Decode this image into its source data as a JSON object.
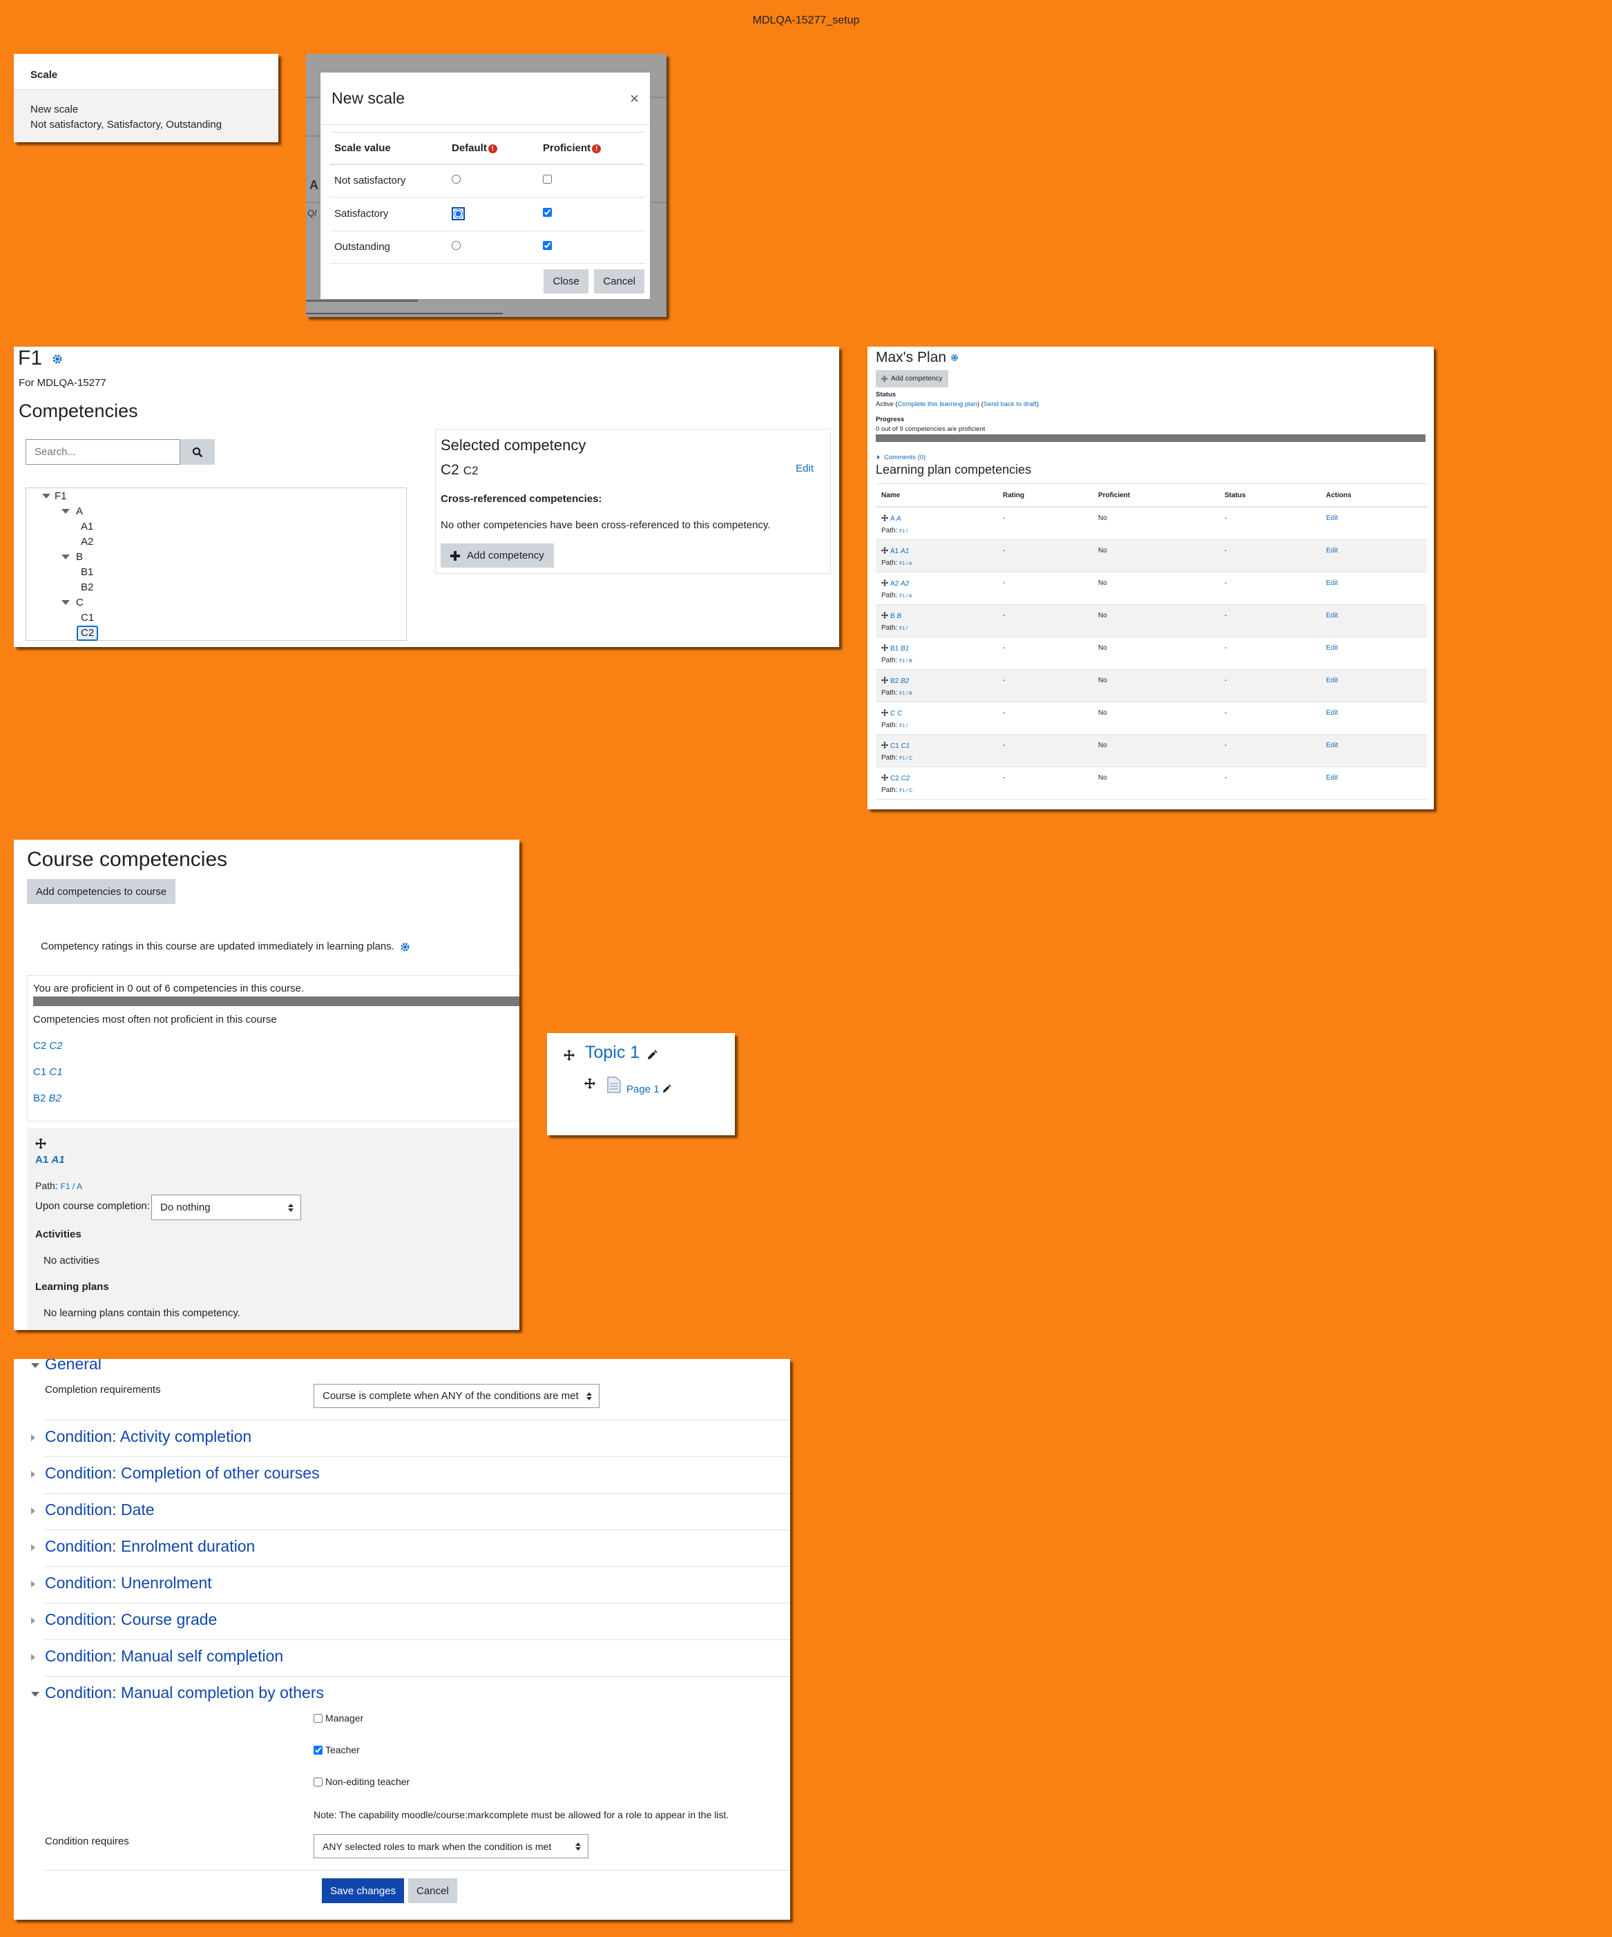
{
  "page_title": "MDLQA-15277_setup",
  "scale_panel": {
    "header": "Scale",
    "name": "New scale",
    "items": "Not satisfactory, Satisfactory, Outstanding"
  },
  "modal": {
    "bg_letters": [
      "A",
      "Q/"
    ],
    "title": "New scale",
    "close_symbol": "×",
    "columns": [
      "Scale value",
      "Default",
      "Proficient"
    ],
    "rows": [
      {
        "label": "Not satisfactory",
        "default": false,
        "proficient": false
      },
      {
        "label": "Satisfactory",
        "default": true,
        "proficient": true
      },
      {
        "label": "Outstanding",
        "default": false,
        "proficient": true
      }
    ],
    "close_button": "Close",
    "cancel_button": "Cancel"
  },
  "framework": {
    "title": "F1",
    "subtitle": "For MDLQA-15277",
    "heading": "Competencies",
    "search_placeholder": "Search...",
    "tree": [
      {
        "label": "F1",
        "level": 0,
        "expanded": true
      },
      {
        "label": "A",
        "level": 1,
        "expanded": true
      },
      {
        "label": "A1",
        "level": 2
      },
      {
        "label": "A2",
        "level": 2
      },
      {
        "label": "B",
        "level": 1,
        "expanded": true
      },
      {
        "label": "B1",
        "level": 2
      },
      {
        "label": "B2",
        "level": 2
      },
      {
        "label": "C",
        "level": 1,
        "expanded": true
      },
      {
        "label": "C1",
        "level": 2
      },
      {
        "label": "C2",
        "level": 2,
        "selected": true
      }
    ],
    "selected": {
      "heading": "Selected competency",
      "edit": "Edit",
      "shortname": "C2",
      "idnumber": "C2",
      "xref_label": "Cross-referenced competencies:",
      "xref_none": "No other competencies have been cross-referenced to this competency.",
      "add_button": "Add competency"
    }
  },
  "plan": {
    "title": "Max's Plan",
    "add_button": "Add competency",
    "status_label": "Status",
    "status_text": "Active",
    "status_link1": "Complete this learning plan",
    "status_link2": "Send back to draft",
    "progress_label": "Progress",
    "progress_text": "0 out of 9 competencies are proficient",
    "comments": "Comments (0)",
    "section_title": "Learning plan competencies",
    "columns": [
      "Name",
      "Rating",
      "Proficient",
      "Status",
      "Actions"
    ],
    "path_label": "Path:",
    "rows": [
      {
        "short": "A",
        "id": "A",
        "path": "F1 /",
        "rating": "-",
        "proficient": "No",
        "status": "-",
        "action": "Edit"
      },
      {
        "short": "A1",
        "id": "A1",
        "path": "F1 / A",
        "rating": "-",
        "proficient": "No",
        "status": "-",
        "action": "Edit"
      },
      {
        "short": "A2",
        "id": "A2",
        "path": "F1 / A",
        "rating": "-",
        "proficient": "No",
        "status": "-",
        "action": "Edit"
      },
      {
        "short": "B",
        "id": "B",
        "path": "F1 /",
        "rating": "-",
        "proficient": "No",
        "status": "-",
        "action": "Edit"
      },
      {
        "short": "B1",
        "id": "B1",
        "path": "F1 / B",
        "rating": "-",
        "proficient": "No",
        "status": "-",
        "action": "Edit"
      },
      {
        "short": "B2",
        "id": "B2",
        "path": "F1 / B",
        "rating": "-",
        "proficient": "No",
        "status": "-",
        "action": "Edit"
      },
      {
        "short": "C",
        "id": "C",
        "path": "F1 /",
        "rating": "-",
        "proficient": "No",
        "status": "-",
        "action": "Edit"
      },
      {
        "short": "C1",
        "id": "C1",
        "path": "F1 / C",
        "rating": "-",
        "proficient": "No",
        "status": "-",
        "action": "Edit"
      },
      {
        "short": "C2",
        "id": "C2",
        "path": "F1 / C",
        "rating": "-",
        "proficient": "No",
        "status": "-",
        "action": "Edit"
      }
    ]
  },
  "course_comp": {
    "title": "Course competencies",
    "add_button": "Add competencies to course",
    "note": "Competency ratings in this course are updated immediately in learning plans.",
    "proficient_text": "You are proficient in 0 out of 6 competencies in this course.",
    "most_often": "Competencies most often not proficient in this course",
    "not_proficient": [
      {
        "short": "C2",
        "id": "C2"
      },
      {
        "short": "C1",
        "id": "C1"
      },
      {
        "short": "B2",
        "id": "B2"
      }
    ],
    "item": {
      "short": "A1",
      "id": "A1",
      "path_label": "Path:",
      "path": "F1 / A",
      "upon_label": "Upon course completion:",
      "upon_value": "Do nothing",
      "activities_label": "Activities",
      "activities_none": "No activities",
      "plans_label": "Learning plans",
      "plans_none": "No learning plans contain this competency."
    }
  },
  "topic": {
    "title": "Topic 1",
    "page": "Page 1"
  },
  "completion": {
    "general": "General",
    "req_label": "Completion requirements",
    "req_value": "Course is complete when ANY of the conditions are met",
    "conditions": [
      "Condition: Activity completion",
      "Condition: Completion of other courses",
      "Condition: Date",
      "Condition: Enrolment duration",
      "Condition: Unenrolment",
      "Condition: Course grade",
      "Condition: Manual self completion",
      "Condition: Manual completion by others"
    ],
    "roles": [
      {
        "label": "Manager",
        "checked": false
      },
      {
        "label": "Teacher",
        "checked": true
      },
      {
        "label": "Non-editing teacher",
        "checked": false
      }
    ],
    "note": "Note: The capability moodle/course:markcomplete must be allowed for a role to appear in the list.",
    "cond_req_label": "Condition requires",
    "cond_req_value": "ANY selected roles to mark when the condition is met",
    "save_button": "Save changes",
    "cancel_button": "Cancel"
  }
}
